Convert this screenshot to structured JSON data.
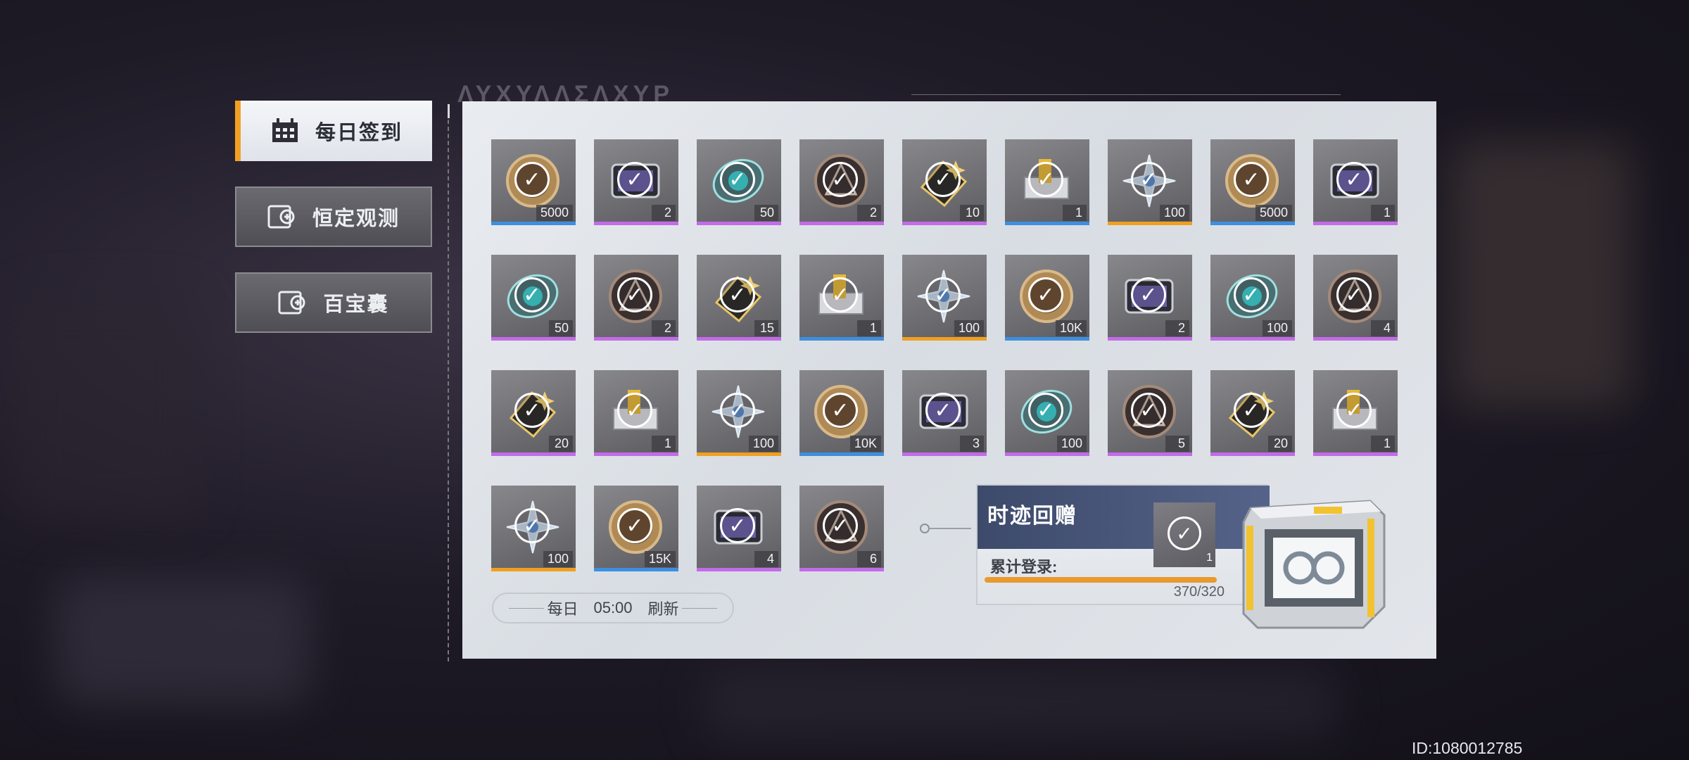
{
  "sidebar": {
    "items": [
      {
        "label": "每日签到",
        "active": true,
        "icon": "calendar-icon"
      },
      {
        "label": "恒定观测",
        "active": false,
        "icon": "observe-icon"
      },
      {
        "label": "百宝囊",
        "active": false,
        "icon": "treasure-bag-icon"
      }
    ]
  },
  "header": {
    "deco_glyphs": "ΛΥΧΥΛΛΣΛΧΥΡ"
  },
  "colors": {
    "rarity_purple": "#c36be8",
    "rarity_blue": "#3d8fe0",
    "rarity_orange": "#f0a020",
    "accent_active": "#f2a024"
  },
  "rewards": [
    {
      "qty": "5000",
      "rarity": "blue",
      "icon": "gold-medal-icon"
    },
    {
      "qty": "2",
      "rarity": "purple",
      "icon": "device-icon"
    },
    {
      "qty": "50",
      "rarity": "purple",
      "icon": "cyan-chip-icon"
    },
    {
      "qty": "2",
      "rarity": "purple",
      "icon": "dark-medal-icon"
    },
    {
      "qty": "10",
      "rarity": "purple",
      "icon": "gold-crystal-icon"
    },
    {
      "qty": "1",
      "rarity": "blue",
      "icon": "yellow-device-icon"
    },
    {
      "qty": "100",
      "rarity": "orange",
      "icon": "star-shard-icon"
    },
    {
      "qty": "5000",
      "rarity": "blue",
      "icon": "gold-medal-icon"
    },
    {
      "qty": "1",
      "rarity": "purple",
      "icon": "device-icon"
    },
    {
      "qty": "50",
      "rarity": "purple",
      "icon": "cyan-chip-icon"
    },
    {
      "qty": "2",
      "rarity": "purple",
      "icon": "dark-medal-icon"
    },
    {
      "qty": "15",
      "rarity": "purple",
      "icon": "gold-crystal-icon"
    },
    {
      "qty": "1",
      "rarity": "blue",
      "icon": "yellow-device-icon"
    },
    {
      "qty": "100",
      "rarity": "orange",
      "icon": "star-shard-icon"
    },
    {
      "qty": "10K",
      "rarity": "blue",
      "icon": "gold-medal-icon"
    },
    {
      "qty": "2",
      "rarity": "purple",
      "icon": "device-icon"
    },
    {
      "qty": "100",
      "rarity": "purple",
      "icon": "cyan-chip-icon"
    },
    {
      "qty": "4",
      "rarity": "purple",
      "icon": "dark-medal-icon"
    },
    {
      "qty": "20",
      "rarity": "purple",
      "icon": "gold-crystal-icon"
    },
    {
      "qty": "1",
      "rarity": "purple",
      "icon": "yellow-device-icon"
    },
    {
      "qty": "100",
      "rarity": "orange",
      "icon": "star-shard-icon"
    },
    {
      "qty": "10K",
      "rarity": "blue",
      "icon": "gold-medal-icon"
    },
    {
      "qty": "3",
      "rarity": "purple",
      "icon": "device-icon"
    },
    {
      "qty": "100",
      "rarity": "purple",
      "icon": "cyan-chip-icon"
    },
    {
      "qty": "5",
      "rarity": "purple",
      "icon": "dark-medal-icon"
    },
    {
      "qty": "20",
      "rarity": "purple",
      "icon": "gold-crystal-icon"
    },
    {
      "qty": "1",
      "rarity": "purple",
      "icon": "yellow-device-icon"
    },
    {
      "qty": "100",
      "rarity": "orange",
      "icon": "star-shard-icon"
    },
    {
      "qty": "15K",
      "rarity": "blue",
      "icon": "gold-medal-icon"
    },
    {
      "qty": "4",
      "rarity": "purple",
      "icon": "device-icon"
    },
    {
      "qty": "6",
      "rarity": "purple",
      "icon": "dark-medal-icon"
    }
  ],
  "refresh": {
    "prefix": "每日",
    "time": "05:00",
    "suffix": "刷新"
  },
  "bonus": {
    "title": "时迹回赠",
    "label": "累计登录:",
    "count": "370/320",
    "progress": 1.0,
    "item_qty": "1"
  },
  "footer": {
    "uid": "ID:1080012785"
  }
}
